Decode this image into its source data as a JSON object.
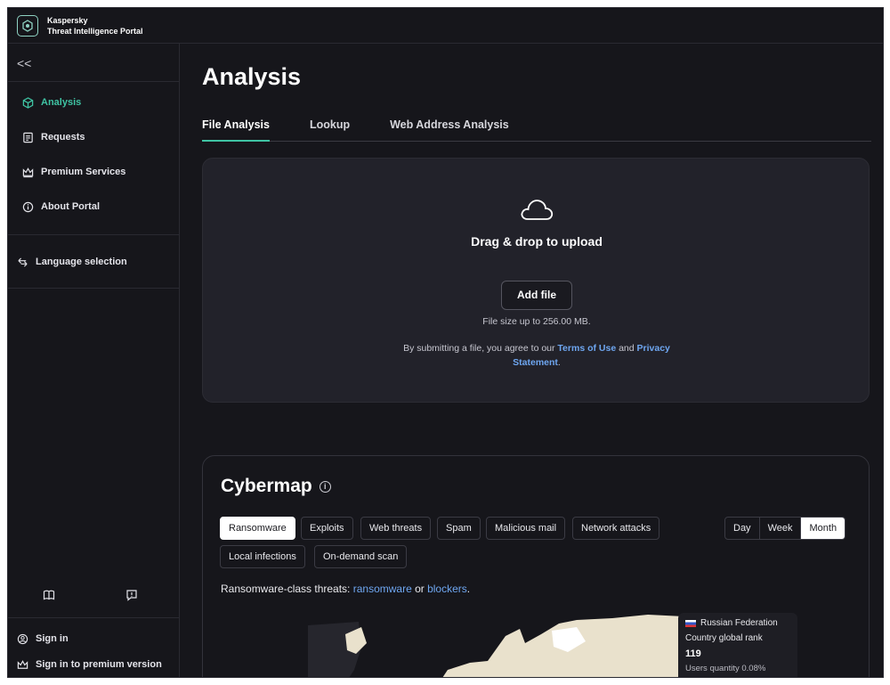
{
  "brand": {
    "line1": "Kaspersky",
    "line2": "Threat Intelligence Portal"
  },
  "sidebar": {
    "collapse_label": "<<",
    "items": [
      {
        "label": "Analysis",
        "icon": "cube-icon",
        "active": true
      },
      {
        "label": "Requests",
        "icon": "document-icon"
      },
      {
        "label": "Premium Services",
        "icon": "crown-icon"
      },
      {
        "label": "About Portal",
        "icon": "info-icon"
      }
    ],
    "language": {
      "label": "Language selection",
      "icon": "language-icon"
    },
    "bottom_icons": [
      "book-icon",
      "feedback-icon"
    ],
    "sign_in": "Sign in",
    "sign_in_premium": "Sign in to premium version"
  },
  "main": {
    "title": "Analysis",
    "tabs": [
      "File Analysis",
      "Lookup",
      "Web Address Analysis"
    ],
    "active_tab": "File Analysis",
    "upload": {
      "heading": "Drag & drop to upload",
      "button": "Add file",
      "file_size": "File size up to 256.00 MB.",
      "terms_prefix": "By submitting a file, you agree to our ",
      "terms_link": "Terms of Use",
      "terms_and": " and ",
      "privacy_link": "Privacy Statement",
      "terms_suffix": "."
    }
  },
  "cybermap": {
    "title": "Cybermap",
    "filters_row1": [
      "Ransomware",
      "Exploits",
      "Web threats",
      "Spam",
      "Malicious mail",
      "Network attacks"
    ],
    "filters_row2": [
      "Local infections",
      "On-demand scan"
    ],
    "selected_filter": "Ransomware",
    "periods": [
      "Day",
      "Week",
      "Month"
    ],
    "selected_period": "Month",
    "threats_prefix": "Ransomware-class threats: ",
    "threats_link1": "ransomware",
    "threats_or": " or ",
    "threats_link2": "blockers",
    "threats_suffix": ".",
    "tooltip": {
      "country": "Russian Federation",
      "rank_label": "Country global rank",
      "rank_value": "119",
      "users_label": "Users quantity",
      "users_value": "0.08%"
    }
  },
  "colors": {
    "accent": "#3fc3a3",
    "link": "#6ea6f0",
    "background": "#16161b",
    "panel": "#22222a"
  }
}
